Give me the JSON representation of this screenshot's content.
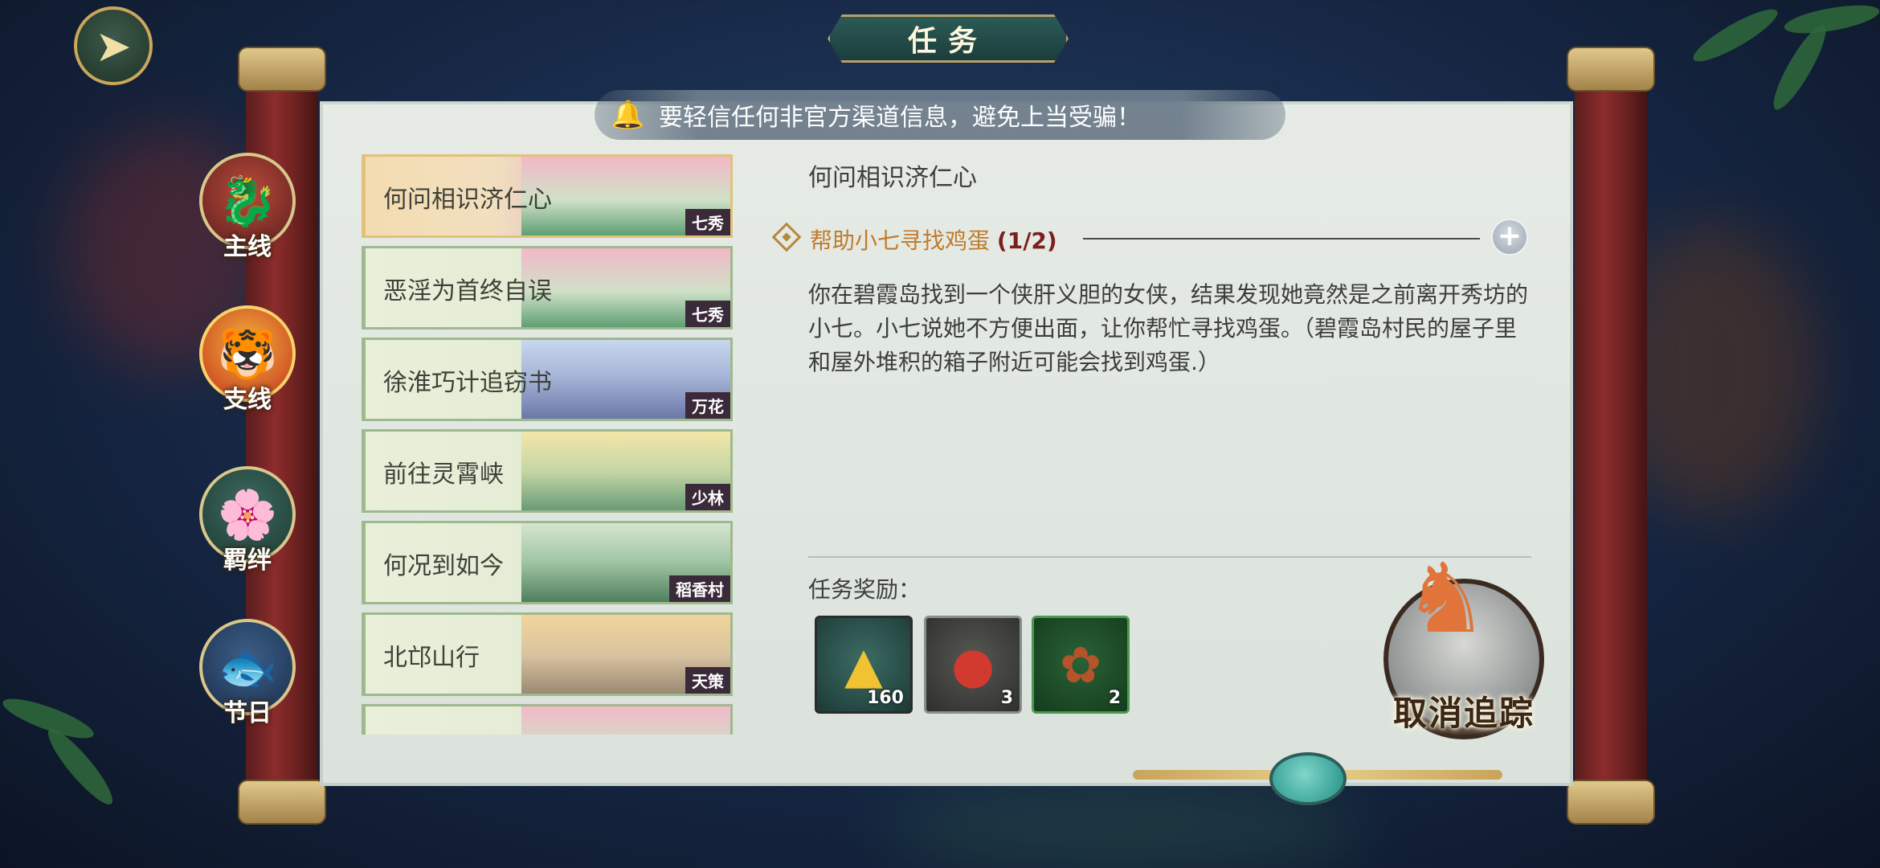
{
  "header": {
    "back_icon": "back-arrow-icon",
    "title": "任务"
  },
  "notice": {
    "icon": "bell-icon",
    "text": "要轻信任何非官方渠道信息，避免上当受骗！"
  },
  "side_nav": [
    {
      "label": "主线",
      "icon": "dragon-icon"
    },
    {
      "label": "支线",
      "icon": "tiger-icon"
    },
    {
      "label": "羁绊",
      "icon": "lotus-bird-icon"
    },
    {
      "label": "节日",
      "icon": "koi-fish-icon"
    }
  ],
  "tasks": [
    {
      "name": "何问相识济仁心",
      "tag": "七秀",
      "active": true
    },
    {
      "name": "恶淫为首终自误",
      "tag": "七秀",
      "active": false
    },
    {
      "name": "徐淮巧计追窃书",
      "tag": "万花",
      "active": false
    },
    {
      "name": "前往灵霄峡",
      "tag": "少林",
      "active": false
    },
    {
      "name": "何况到如今",
      "tag": "稻香村",
      "active": false
    },
    {
      "name": "北邙山行",
      "tag": "天策",
      "active": false
    }
  ],
  "detail": {
    "title": "何问相识济仁心",
    "objective_text": "帮助小七寻找鸡蛋",
    "objective_count": "(1/2)",
    "description": "你在碧霞岛找到一个侠肝义胆的女侠，结果发现她竟然是之前离开秀坊的小七。小七说她不方便出面，让你帮忙寻找鸡蛋。（碧霞岛村民的屋子里和屋外堆积的箱子附近可能会找到鸡蛋.）",
    "reward_label": "任务奖励：",
    "rewards": [
      {
        "icon": "gold-ingot-icon",
        "qty": "160"
      },
      {
        "icon": "red-pill-icon",
        "qty": "3"
      },
      {
        "icon": "firefly-icon",
        "qty": "2"
      }
    ],
    "cancel_track_label": "取消追踪"
  },
  "colors": {
    "objective": "#c07b2b",
    "count": "#7b1f1f",
    "scroll_bg": "#e2e8e1"
  }
}
